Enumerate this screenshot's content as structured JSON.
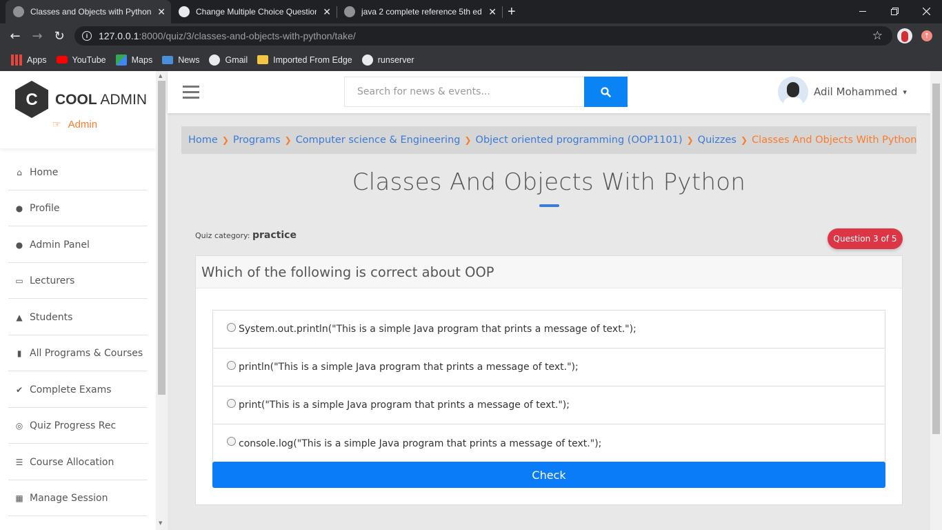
{
  "browser": {
    "tabs": [
      {
        "title": "Classes and Objects with Python",
        "active": true
      },
      {
        "title": "Change Multiple Choice Question",
        "active": false
      },
      {
        "title": "java 2 complete reference 5th ed",
        "active": false
      }
    ],
    "url_host": "127.0.0.1",
    "url_path": ":8000/quiz/3/classes-and-objects-with-python/take/",
    "bookmarks": [
      "Apps",
      "YouTube",
      "Maps",
      "News",
      "Gmail",
      "Imported From Edge",
      "runserver"
    ]
  },
  "sidebar": {
    "brand_bold": "COOL",
    "brand_light": " ADMIN",
    "logo_letter": "C",
    "role": "Admin",
    "items": [
      {
        "label": "Home",
        "icon": "home-icon"
      },
      {
        "label": "Profile",
        "icon": "user-icon"
      },
      {
        "label": "Admin Panel",
        "icon": "user-tie-icon"
      },
      {
        "label": "Lecturers",
        "icon": "chalkboard-teacher-icon"
      },
      {
        "label": "Students",
        "icon": "graduate-icon"
      },
      {
        "label": "All Programs & Courses",
        "icon": "book-open-icon"
      },
      {
        "label": "Complete Exams",
        "icon": "check-double-icon"
      },
      {
        "label": "Quiz Progress Rec",
        "icon": "record-icon"
      },
      {
        "label": "Course Allocation",
        "icon": "tasks-icon"
      },
      {
        "label": "Manage Session",
        "icon": "calendar-icon"
      }
    ]
  },
  "header": {
    "search_placeholder": "Search for news & events...",
    "user_name": "Adil Mohammed"
  },
  "breadcrumb": {
    "links": [
      "Home",
      "Programs",
      "Computer science & Engineering",
      "Object oriented programming (OOP1101)",
      "Quizzes"
    ],
    "current": "Classes And Objects With Python"
  },
  "quiz": {
    "title": "Classes And Objects With Python",
    "category_label": "Quiz category:",
    "category": "practice",
    "progress": "Question 3 of 5",
    "question": "Which of the following is correct about OOP",
    "options": [
      "System.out.println(\"This is a simple Java program that prints a message of text.\");",
      "println(\"This is a simple Java program that prints a message of text.\");",
      "print(\"This is a simple Java program that prints a message of text.\");",
      "console.log(\"This is a simple Java program that prints a message of text.\");"
    ],
    "submit_label": "Check"
  },
  "colors": {
    "accent": "#0a84f5",
    "orange": "#fa7b2b",
    "badge": "#dc3545",
    "link": "#3a7bd5"
  }
}
